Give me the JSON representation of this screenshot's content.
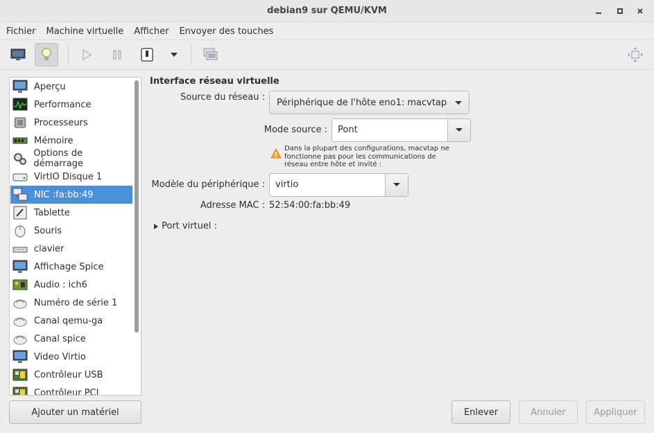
{
  "window": {
    "title": "debian9 sur QEMU/KVM"
  },
  "menu": [
    "Fichier",
    "Machine virtuelle",
    "Afficher",
    "Envoyer des touches"
  ],
  "sidebar": {
    "items": [
      {
        "label": "Aperçu",
        "icon": "monitor-icon"
      },
      {
        "label": "Performance",
        "icon": "performance-chart-icon"
      },
      {
        "label": "Processeurs",
        "icon": "cpu-chip-icon"
      },
      {
        "label": "Mémoire",
        "icon": "memory-module-icon"
      },
      {
        "label": "Options de démarrage",
        "icon": "boot-gears-icon"
      },
      {
        "label": "VirtIO Disque 1",
        "icon": "disk-drive-icon"
      },
      {
        "label": "NIC :fa:bb:49",
        "icon": "network-card-icon",
        "selected": true
      },
      {
        "label": "Tablette",
        "icon": "tablet-icon"
      },
      {
        "label": "Souris",
        "icon": "mouse-icon"
      },
      {
        "label": "clavier",
        "icon": "keyboard-icon"
      },
      {
        "label": "Affichage Spice",
        "icon": "display-icon"
      },
      {
        "label": "Audio : ich6",
        "icon": "sound-card-icon"
      },
      {
        "label": "Numéro de série 1",
        "icon": "serial-port-icon"
      },
      {
        "label": "Canal qemu-ga",
        "icon": "channel-icon"
      },
      {
        "label": "Canal spice",
        "icon": "channel-icon"
      },
      {
        "label": "Video Virtio",
        "icon": "video-monitor-icon"
      },
      {
        "label": "Contrôleur USB",
        "icon": "controller-board-icon"
      },
      {
        "label": "Contrôleur PCI",
        "icon": "controller-board-icon"
      }
    ],
    "add_button": "Ajouter un matériel"
  },
  "panel": {
    "title": "Interface réseau virtuelle",
    "source_label": "Source du réseau :",
    "source_value": "Périphérique de l'hôte eno1: macvtap",
    "mode_label": "Mode source :",
    "mode_value": "Pont",
    "warning": "Dans la plupart des configurations, macvtap ne fonctionne pas pour les communications de réseau entre hôte et invité :",
    "model_label": "Modèle du périphérique :",
    "model_value": "virtio",
    "mac_label": "Adresse MAC :",
    "mac_value": "52:54:00:fa:bb:49",
    "virtual_port": "Port virtuel :"
  },
  "buttons": {
    "remove": "Enlever",
    "cancel": "Annuler",
    "apply": "Appliquer"
  }
}
